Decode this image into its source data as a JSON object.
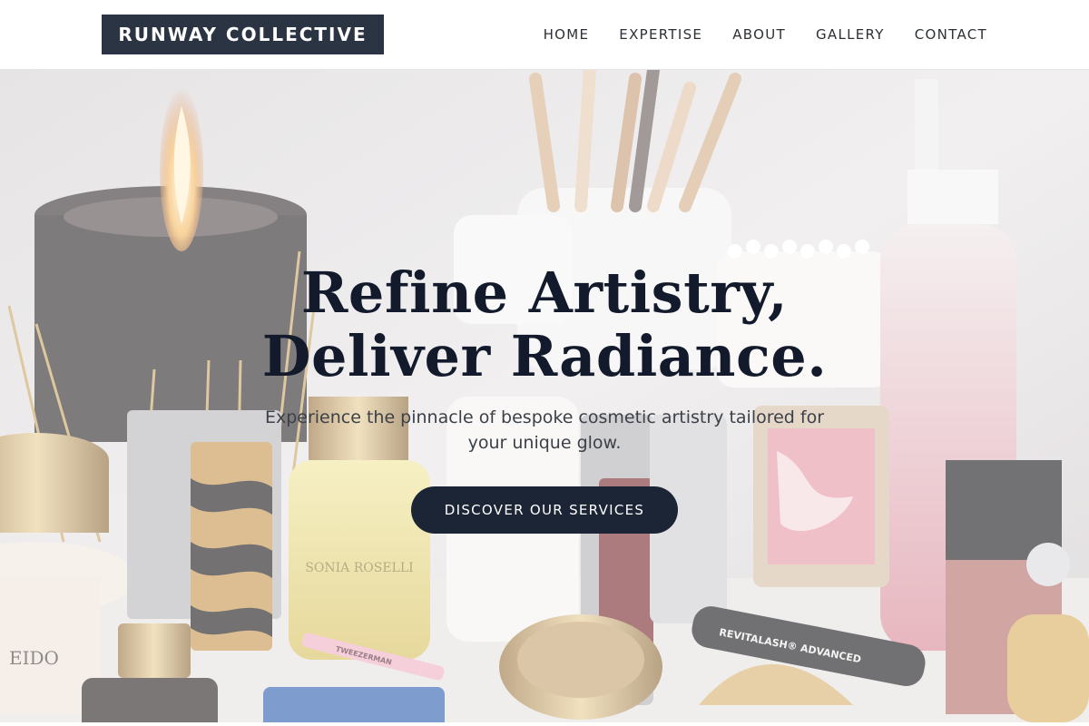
{
  "brand": {
    "name": "RUNWAY COLLECTIVE"
  },
  "nav": {
    "items": [
      {
        "label": "HOME"
      },
      {
        "label": "EXPERTISE"
      },
      {
        "label": "ABOUT"
      },
      {
        "label": "GALLERY"
      },
      {
        "label": "CONTACT"
      }
    ]
  },
  "hero": {
    "title_line1": "Refine Artistry,",
    "title_line2": "Deliver Radiance.",
    "subtitle": "Experience the pinnacle of bespoke cosmetic artistry tailored for your unique glow.",
    "cta_label": "DISCOVER OUR SERVICES",
    "background_image": "cosmetics-flatlay-photo",
    "product_labels": {
      "mascara": "REVITALASH® ADVANCED",
      "serum": "SONIA ROSELLI",
      "tweezers": "TWEEZERMAN"
    }
  },
  "colors": {
    "brand_bg": "#2b3443",
    "cta_bg": "#1c2536",
    "title_text": "#121a2c",
    "nav_text": "#2d3036"
  }
}
